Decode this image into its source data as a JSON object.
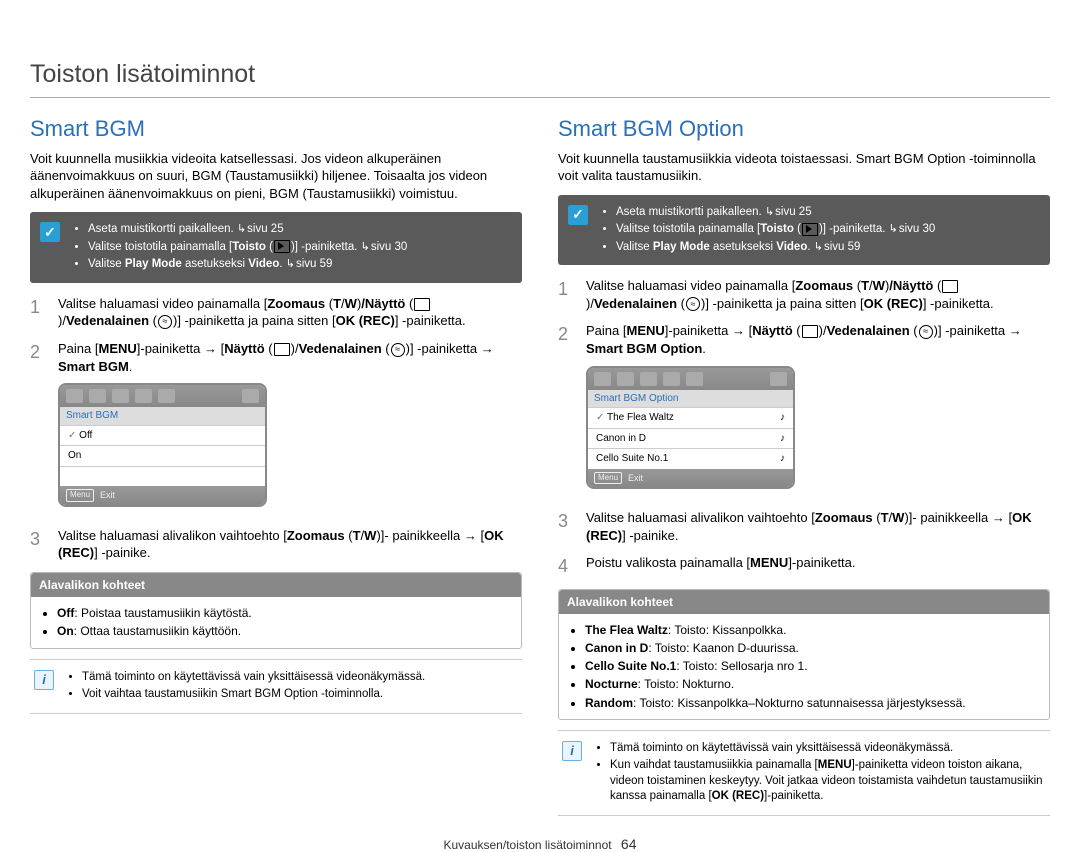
{
  "page": {
    "title": "Toiston lisätoiminnot",
    "footer_text": "Kuvauksen/toiston lisätoiminnot",
    "footer_page": "64"
  },
  "left": {
    "heading": "Smart BGM",
    "intro": "Voit kuunnella musiikkia videoita katsellessasi. Jos videon alkuperäinen äänenvoimakkuus on suuri, BGM (Taustamusiikki) hiljenee. Toisaalta jos videon alkuperäinen äänenvoimakkuus on pieni, BGM (Taustamusiikki) voimistuu.",
    "note": {
      "items": [
        {
          "pre": "Aseta muistikortti paikalleen. ",
          "ref": "sivu 25",
          "seg": []
        },
        {
          "pre": "Valitse toistotila painamalla [",
          "bold": "Toisto",
          "post": " (",
          "glyph": "play",
          "post2": ")] -painiketta. ",
          "ref": "sivu 30"
        },
        {
          "pre": "Valitse ",
          "bold": "Play Mode",
          "mid": " asetukseksi ",
          "bold2": "Video",
          "post": ". ",
          "ref": "sivu 59"
        }
      ]
    },
    "steps": {
      "s1": "painiketta.",
      "s1_b1": "Zoomaus",
      "s1_p1": " (",
      "s1_b2": "T",
      "s1_p2": "/",
      "s1_b3": "W",
      "s1_p3": ")",
      "s1_b4": "/Näyttö",
      "s1_pre": "Valitse haluamasi video painamalla [",
      "s1_mid": " (",
      "s1_p4": ")/",
      "s1_b5": "Vedenalainen",
      "s1_p5": " (",
      "s1_p6": ")] -painiketta ja paina sitten [",
      "s1_b6": "OK (REC)",
      "s1_p7": "] -",
      "s2_pre": "Paina [",
      "s2_b1": "MENU",
      "s2_p1": "]-painiketta ",
      "s2_arr": "→",
      "s2_p2": " [",
      "s2_b2": "Näyttö",
      "s2_p3": " (",
      "s2_p4": ")/",
      "s2_b3": "Vedenalainen",
      "s2_p5": " (",
      "s2_p6": ")] -painiketta ",
      "s2_arr2": "→",
      "s2_b4": " Smart BGM",
      "s2_end": ".",
      "s3_pre": "Valitse haluamasi alivalikon vaihtoehto [",
      "s3_b1": "Zoomaus",
      "s3_p1": " (",
      "s3_b2": "T",
      "s3_p2": "/",
      "s3_b3": "W",
      "s3_p3": ")]- painikkeella ",
      "s3_arr": "→",
      "s3_p4": " [",
      "s3_b4": "OK (REC)",
      "s3_p5": "] -painike."
    },
    "screen": {
      "header": "Smart BGM",
      "rows": [
        {
          "tick": "✓",
          "label": "Off"
        },
        {
          "tick": "",
          "label": "On"
        }
      ],
      "footer_menu": "Menu",
      "footer_exit": "Exit"
    },
    "sub": {
      "header": "Alavalikon kohteet",
      "items": [
        {
          "b": "Off",
          "t": ": Poistaa taustamusiikin käytöstä."
        },
        {
          "b": "On",
          "t": ": Ottaa taustamusiikin käyttöön."
        }
      ]
    },
    "info": {
      "items": [
        "Tämä toiminto on käytettävissä vain yksittäisessä videonäkymässä.",
        "Voit vaihtaa taustamusiikin Smart BGM Option -toiminnolla."
      ]
    }
  },
  "right": {
    "heading": "Smart BGM Option",
    "intro": "Voit kuunnella taustamusiikkia videota toistaessasi. Smart BGM Option -toiminnolla voit valita taustamusiikin.",
    "note": {
      "items": [
        {
          "pre": "Aseta muistikortti paikalleen. ",
          "ref": "sivu 25",
          "seg": []
        },
        {
          "pre": "Valitse toistotila painamalla [",
          "bold": "Toisto",
          "post": " (",
          "glyph": "play",
          "post2": ")] -painiketta. ",
          "ref": "sivu 30"
        },
        {
          "pre": "Valitse ",
          "bold": "Play Mode",
          "mid": " asetukseksi ",
          "bold2": "Video",
          "post": ". ",
          "ref": "sivu 59"
        }
      ]
    },
    "steps": {
      "s1": "painiketta.",
      "s1_pre": "Valitse haluamasi video painamalla [",
      "s1_b1": "Zoomaus",
      "s1_p1": " (",
      "s1_b2": "T",
      "s1_p2": "/",
      "s1_b3": "W",
      "s1_p3": ")",
      "s1_b4": "/Näyttö",
      "s1_mid": " (",
      "s1_p4": ")/",
      "s1_b5": "Vedenalainen",
      "s1_p5": " (",
      "s1_p6": ")] -painiketta ja paina sitten [",
      "s1_b6": "OK (REC)",
      "s1_p7": "] -",
      "s2_pre": "Paina [",
      "s2_b1": "MENU",
      "s2_p1": "]-painiketta ",
      "s2_arr": "→",
      "s2_p2": " [",
      "s2_b2": "Näyttö",
      "s2_p3": " (",
      "s2_p4": ")/",
      "s2_b3": "Vedenalainen",
      "s2_p5": " (",
      "s2_p6": ")] -painiketta ",
      "s2_arr2": "→",
      "s2_b4": " Smart BGM Option",
      "s2_end": ".",
      "s3_pre": "Valitse haluamasi alivalikon vaihtoehto [",
      "s3_b1": "Zoomaus",
      "s3_p1": " (",
      "s3_b2": "T",
      "s3_p2": "/",
      "s3_b3": "W",
      "s3_p3": ")]- painikkeella ",
      "s3_arr": "→",
      "s3_p4": " [",
      "s3_b4": "OK (REC)",
      "s3_p5": "] -painike.",
      "s4_pre": "Poistu valikosta painamalla [",
      "s4_b1": "MENU",
      "s4_p1": "]-painiketta."
    },
    "screen": {
      "header": "Smart BGM Option",
      "rows": [
        {
          "tick": "✓",
          "label": "The Flea Waltz",
          "note": "♪"
        },
        {
          "tick": "",
          "label": "Canon in D",
          "note": "♪"
        },
        {
          "tick": "",
          "label": "Cello Suite No.1",
          "note": "♪"
        }
      ],
      "footer_menu": "Menu",
      "footer_exit": "Exit"
    },
    "sub": {
      "header": "Alavalikon kohteet",
      "items": [
        {
          "b": "The Flea Waltz",
          "t": ": Toisto: Kissanpolkka."
        },
        {
          "b": "Canon in D",
          "t": ": Toisto: Kaanon D-duurissa."
        },
        {
          "b": "Cello Suite No.1",
          "t": ": Toisto: Sellosarja nro 1."
        },
        {
          "b": "Nocturne",
          "t": ": Toisto: Nokturno."
        },
        {
          "b": "Random",
          "t": ": Toisto: Kissanpolkka–Nokturno satunnaisessa järjestyksessä."
        }
      ]
    },
    "info": {
      "i0": "Tämä toiminto on käytettävissä vain yksittäisessä videonäkymässä.",
      "i1_pre": "Kun vaihdat taustamusiikkia painamalla [",
      "i1_b1": "MENU",
      "i1_mid": "]-painiketta videon toiston aikana, videon toistaminen keskeytyy. Voit jatkaa videon toistamista vaihdetun taustamusiikin kanssa painamalla [",
      "i1_b2": "OK (REC)",
      "i1_end": "]-painiketta."
    }
  }
}
